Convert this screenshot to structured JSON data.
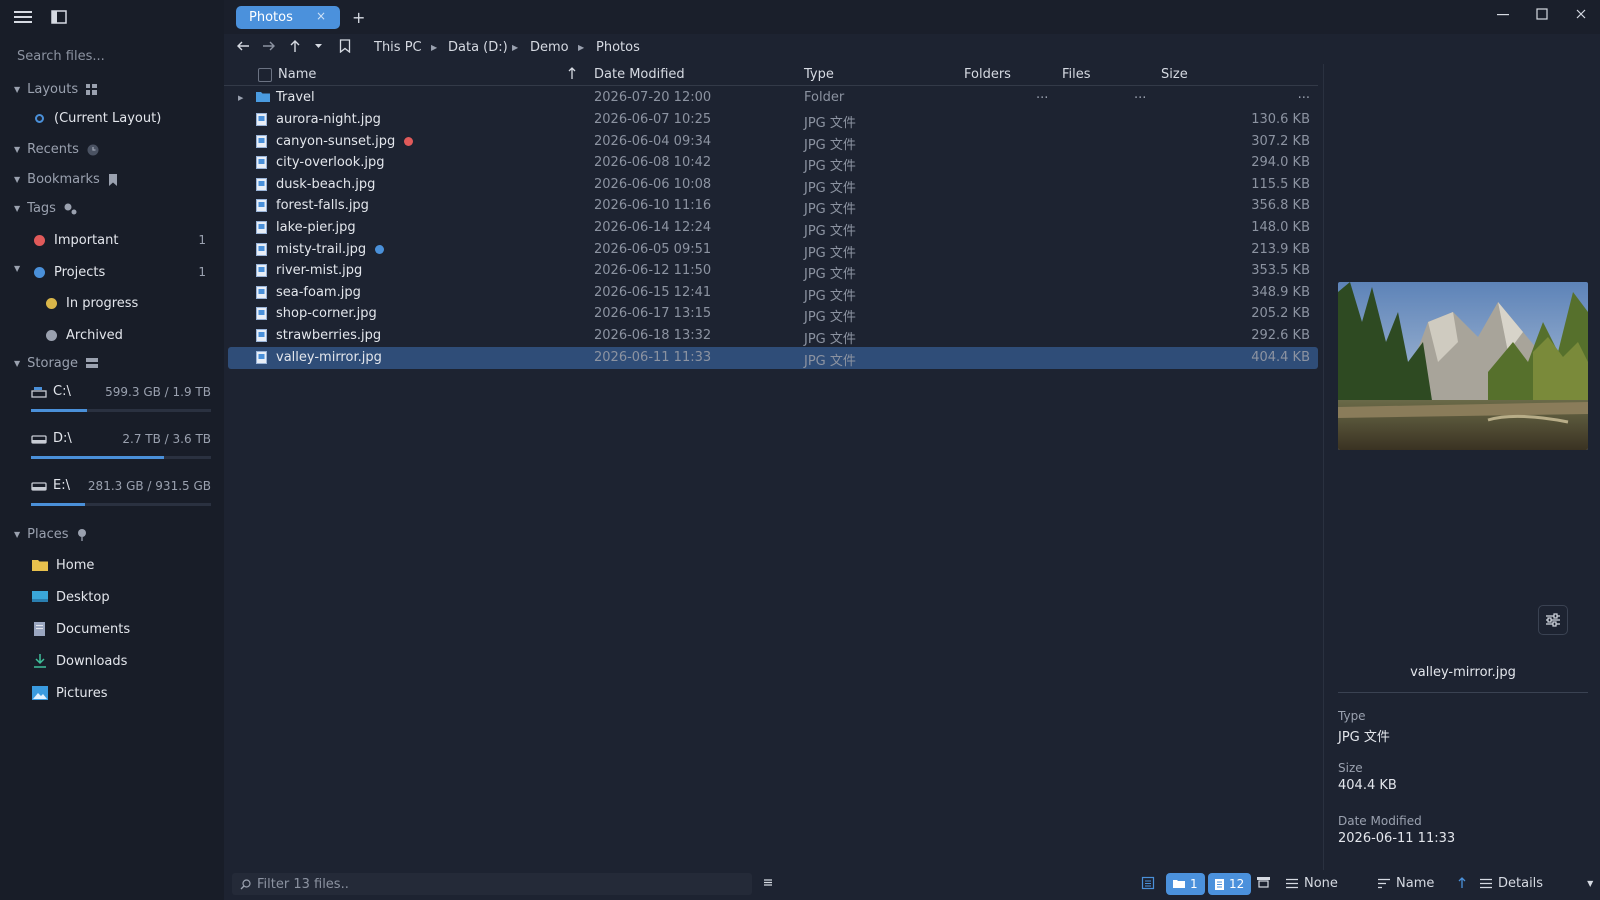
{
  "sidebar": {
    "search_placeholder": "Search files...",
    "layouts": {
      "title": "Layouts",
      "items": [
        {
          "label": "(Current Layout)"
        }
      ]
    },
    "recents": {
      "title": "Recents"
    },
    "bookmarks": {
      "title": "Bookmarks"
    },
    "tags": {
      "title": "Tags",
      "items": [
        {
          "label": "Important",
          "count": "1",
          "color": "#e05a5a"
        },
        {
          "label": "Projects",
          "count": "1",
          "color": "#4a90d9"
        },
        {
          "label": "In progress",
          "count": "",
          "color": "#d9b64a"
        },
        {
          "label": "Archived",
          "count": "",
          "color": "#9aa1af"
        }
      ]
    },
    "storage": {
      "title": "Storage",
      "drives": [
        {
          "label": "C:\\",
          "usage": "599.3 GB / 1.9 TB",
          "fraction": 0.31
        },
        {
          "label": "D:\\",
          "usage": "2.7 TB / 3.6 TB",
          "fraction": 0.74
        },
        {
          "label": "E:\\",
          "usage": "281.3 GB / 931.5 GB",
          "fraction": 0.3
        }
      ]
    },
    "places": {
      "title": "Places",
      "items": [
        {
          "label": "Home"
        },
        {
          "label": "Desktop"
        },
        {
          "label": "Documents"
        },
        {
          "label": "Downloads"
        },
        {
          "label": "Pictures"
        }
      ]
    }
  },
  "tabbar": {
    "tab_label": "Photos",
    "new_tab": "+"
  },
  "breadcrumb": [
    "This PC",
    "Data (D:)",
    "Demo",
    "Photos"
  ],
  "columns": {
    "name": "Name",
    "date": "Date Modified",
    "type": "Type",
    "folders": "Folders",
    "files": "Files",
    "size": "Size"
  },
  "folder_row": {
    "name": "Travel",
    "date": "2026-07-20 12:00",
    "type": "Folder",
    "folders": "...",
    "files": "...",
    "size": "..."
  },
  "files": [
    {
      "name": "aurora-night.jpg",
      "date": "2026-06-07 10:25",
      "type": "JPG 文件",
      "size": "130.6 KB"
    },
    {
      "name": "canyon-sunset.jpg",
      "date": "2026-06-04 09:34",
      "type": "JPG 文件",
      "size": "307.2 KB"
    },
    {
      "name": "city-overlook.jpg",
      "date": "2026-06-08 10:42",
      "type": "JPG 文件",
      "size": "294.0 KB"
    },
    {
      "name": "dusk-beach.jpg",
      "date": "2026-06-06 10:08",
      "type": "JPG 文件",
      "size": "115.5 KB"
    },
    {
      "name": "forest-falls.jpg",
      "date": "2026-06-10 11:16",
      "type": "JPG 文件",
      "size": "356.8 KB"
    },
    {
      "name": "lake-pier.jpg",
      "date": "2026-06-14 12:24",
      "type": "JPG 文件",
      "size": "148.0 KB"
    },
    {
      "name": "misty-trail.jpg",
      "date": "2026-06-05 09:51",
      "type": "JPG 文件",
      "size": "213.9 KB"
    },
    {
      "name": "river-mist.jpg",
      "date": "2026-06-12 11:50",
      "type": "JPG 文件",
      "size": "353.5 KB"
    },
    {
      "name": "sea-foam.jpg",
      "date": "2026-06-15 12:41",
      "type": "JPG 文件",
      "size": "348.9 KB"
    },
    {
      "name": "shop-corner.jpg",
      "date": "2026-06-17 13:15",
      "type": "JPG 文件",
      "size": "205.2 KB"
    },
    {
      "name": "strawberries.jpg",
      "date": "2026-06-18 13:32",
      "type": "JPG 文件",
      "size": "292.6 KB"
    },
    {
      "name": "valley-mirror.jpg",
      "date": "2026-06-11 11:33",
      "type": "JPG 文件",
      "size": "404.4 KB"
    }
  ],
  "tag_colors": {
    "red": "#e05a5a",
    "blue": "#4a90d9"
  },
  "preview": {
    "name": "valley-mirror.jpg",
    "type_label": "Type",
    "type_value": "JPG 文件",
    "size_label": "Size",
    "size_value": "404.4 KB",
    "date_label": "Date Modified",
    "date_value": "2026-06-11 11:33"
  },
  "statusbar": {
    "filter_placeholder": "Filter 13 files..",
    "folder_count": "1",
    "file_count": "12",
    "group_label": "None",
    "sort_label": "Name",
    "view_label": "Details"
  }
}
